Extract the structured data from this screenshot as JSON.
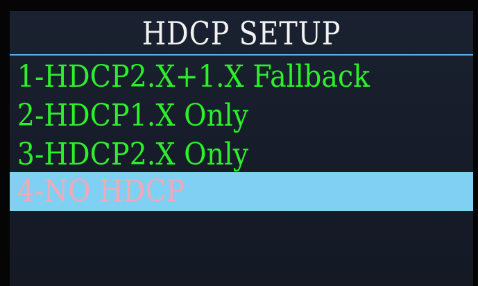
{
  "screen": {
    "title": "HDCP SETUP"
  },
  "menu": {
    "items": [
      {
        "label": "1-HDCP2.X+1.X Fallback",
        "selected": false
      },
      {
        "label": "2-HDCP1.X Only",
        "selected": false
      },
      {
        "label": "3-HDCP2.X Only",
        "selected": false
      },
      {
        "label": "4-NO HDCP",
        "selected": true
      }
    ]
  },
  "colors": {
    "item_text": "#2cf02a",
    "selected_background": "#7fd0f2",
    "selected_text": "#f2a8b6",
    "title_text": "#f2f2f2",
    "divider": "#5aaee8"
  }
}
